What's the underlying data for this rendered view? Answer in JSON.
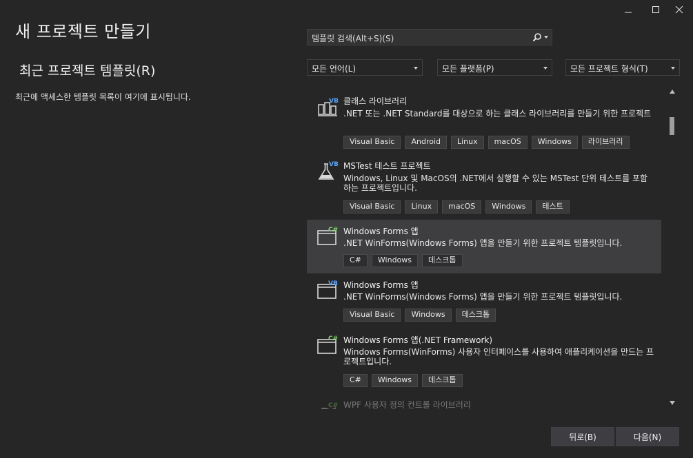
{
  "page": {
    "title": "새 프로젝트 만들기",
    "recent_title": "최근 프로젝트 템플릿(R)",
    "recent_desc": "최근에 액세스한 템플릿 목록이 여기에 표시됩니다."
  },
  "search": {
    "placeholder": "템플릿 검색(Alt+S)(S)"
  },
  "filters": {
    "language": "모든 언어(L)",
    "platform": "모든 플랫폼(P)",
    "project_type": "모든 프로젝트 형식(T)"
  },
  "templates": [
    {
      "name": "클래스 라이브러리",
      "desc": ".NET 또는 .NET Standard를 대상으로 하는 클래스 라이브러리를 만들기 위한 프로젝트",
      "badge": "VB",
      "icon": "class-library-icon",
      "tags": [
        "Visual Basic",
        "Android",
        "Linux",
        "macOS",
        "Windows",
        "라이브러리"
      ]
    },
    {
      "name": "MSTest 테스트 프로젝트",
      "desc": "Windows, Linux 및 MacOS의 .NET에서 실행할 수 있는 MSTest 단위 테스트를 포함하는 프로젝트입니다.",
      "badge": "VB",
      "icon": "test-flask-icon",
      "tags": [
        "Visual Basic",
        "Linux",
        "macOS",
        "Windows",
        "테스트"
      ]
    },
    {
      "name": "Windows Forms 앱",
      "desc": ".NET WinForms(Windows Forms) 앱을 만들기 위한 프로젝트 템플릿입니다.",
      "badge": "C#",
      "icon": "windows-form-icon",
      "tags": [
        "C#",
        "Windows",
        "데스크톱"
      ]
    },
    {
      "name": "Windows Forms 앱",
      "desc": ".NET WinForms(Windows Forms) 앱을 만들기 위한 프로젝트 템플릿입니다.",
      "badge": "VB",
      "icon": "windows-form-icon",
      "tags": [
        "Visual Basic",
        "Windows",
        "데스크톱"
      ]
    },
    {
      "name": "Windows Forms 앱(.NET Framework)",
      "desc": "Windows Forms(WinForms) 사용자 인터페이스를 사용하여 애플리케이션을 만드는 프로젝트입니다.",
      "badge": "C#",
      "icon": "windows-form-icon",
      "tags": [
        "C#",
        "Windows",
        "데스크톱"
      ]
    },
    {
      "name": "WPF 사용자 정의 컨트롤 라이브러리",
      "desc": "",
      "badge": "C#",
      "icon": "wpf-control-icon",
      "tags": []
    }
  ],
  "buttons": {
    "back": "뒤로(B)",
    "next": "다음(N)"
  },
  "colors": {
    "badge_vb": "#5aa7ff",
    "badge_cs": "#7fd36b",
    "selected": "#3e3e40"
  }
}
